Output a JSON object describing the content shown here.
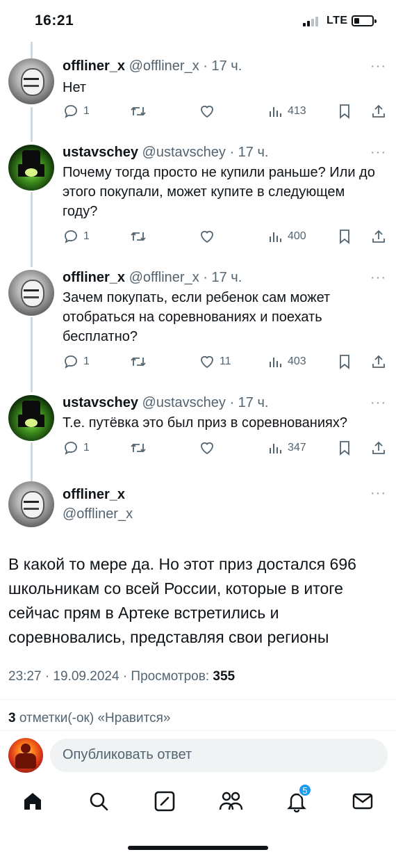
{
  "status_bar": {
    "time": "16:21",
    "network": "LTE",
    "battery_level": 0.2
  },
  "tweets": [
    {
      "name": "offliner_x",
      "handle": "@offliner_x",
      "time": "· 17 ч.",
      "text": "Нет",
      "replies": "1",
      "retweets": "",
      "likes": "",
      "views": "413",
      "avatar": "gray-face-avatar"
    },
    {
      "name": "ustavschey",
      "handle": "@ustavschey",
      "time": "· 17 ч.",
      "text": "Почему тогда просто не купили раньше? Или до этого покупали, может купите в следующем году?",
      "replies": "1",
      "retweets": "",
      "likes": "",
      "views": "400",
      "avatar": "green-figure-avatar"
    },
    {
      "name": "offliner_x",
      "handle": "@offliner_x",
      "time": "· 17 ч.",
      "text": "Зачем покупать, если ребенок сам может отобраться на соревнованиях и поехать бесплатно?",
      "replies": "1",
      "retweets": "",
      "likes": "11",
      "views": "403",
      "avatar": "gray-face-avatar"
    },
    {
      "name": "ustavschey",
      "handle": "@ustavschey",
      "time": "· 17 ч.",
      "text": "Т.е. путёвка это был приз в соревнованиях?",
      "replies": "1",
      "retweets": "",
      "likes": "",
      "views": "347",
      "avatar": "green-figure-avatar"
    }
  ],
  "focus_tweet": {
    "name": "offliner_x",
    "handle": "@offliner_x",
    "text": "В какой то мере да. Но этот приз достался 696 школьникам со всей России, которые в итоге сейчас прям в Артеке встретились и соревновались, представляя свои регионы",
    "timestamp": "23:27 · 19.09.2024 · Просмотров:",
    "views": "355",
    "likes_count": "3",
    "likes_label": "отметки(-ок) «Нравится»"
  },
  "reply": {
    "placeholder": "Опубликовать ответ"
  },
  "tabbar": {
    "items": [
      "home-icon",
      "search-icon",
      "compose-icon",
      "communities-icon",
      "notifications-icon",
      "messages-icon"
    ],
    "notifications_badge": "5"
  },
  "colors": {
    "text": "#0f1419",
    "secondary": "#536471",
    "accent": "#1d9bf0",
    "thread_line": "#cfd9de"
  }
}
